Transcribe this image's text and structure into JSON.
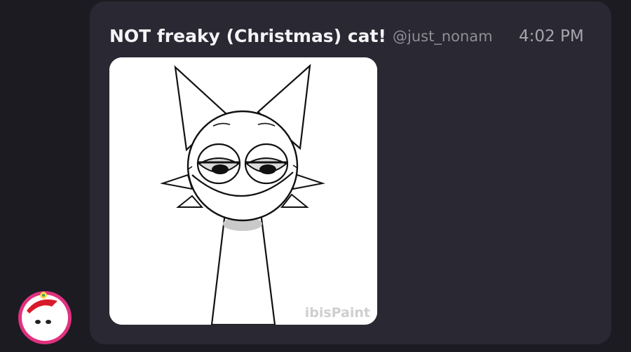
{
  "message": {
    "title": "NOT freaky (Christmas) cat!",
    "handle": "@just_nonam",
    "time": "4:02 PM",
    "watermark": "ibisPaint"
  },
  "colors": {
    "page_background": "#1c1b22",
    "bubble_background": "#2a2833",
    "title_text": "#f4f4f6",
    "muted_text": "#8f8e96",
    "avatar_ring": "#e0317f"
  }
}
